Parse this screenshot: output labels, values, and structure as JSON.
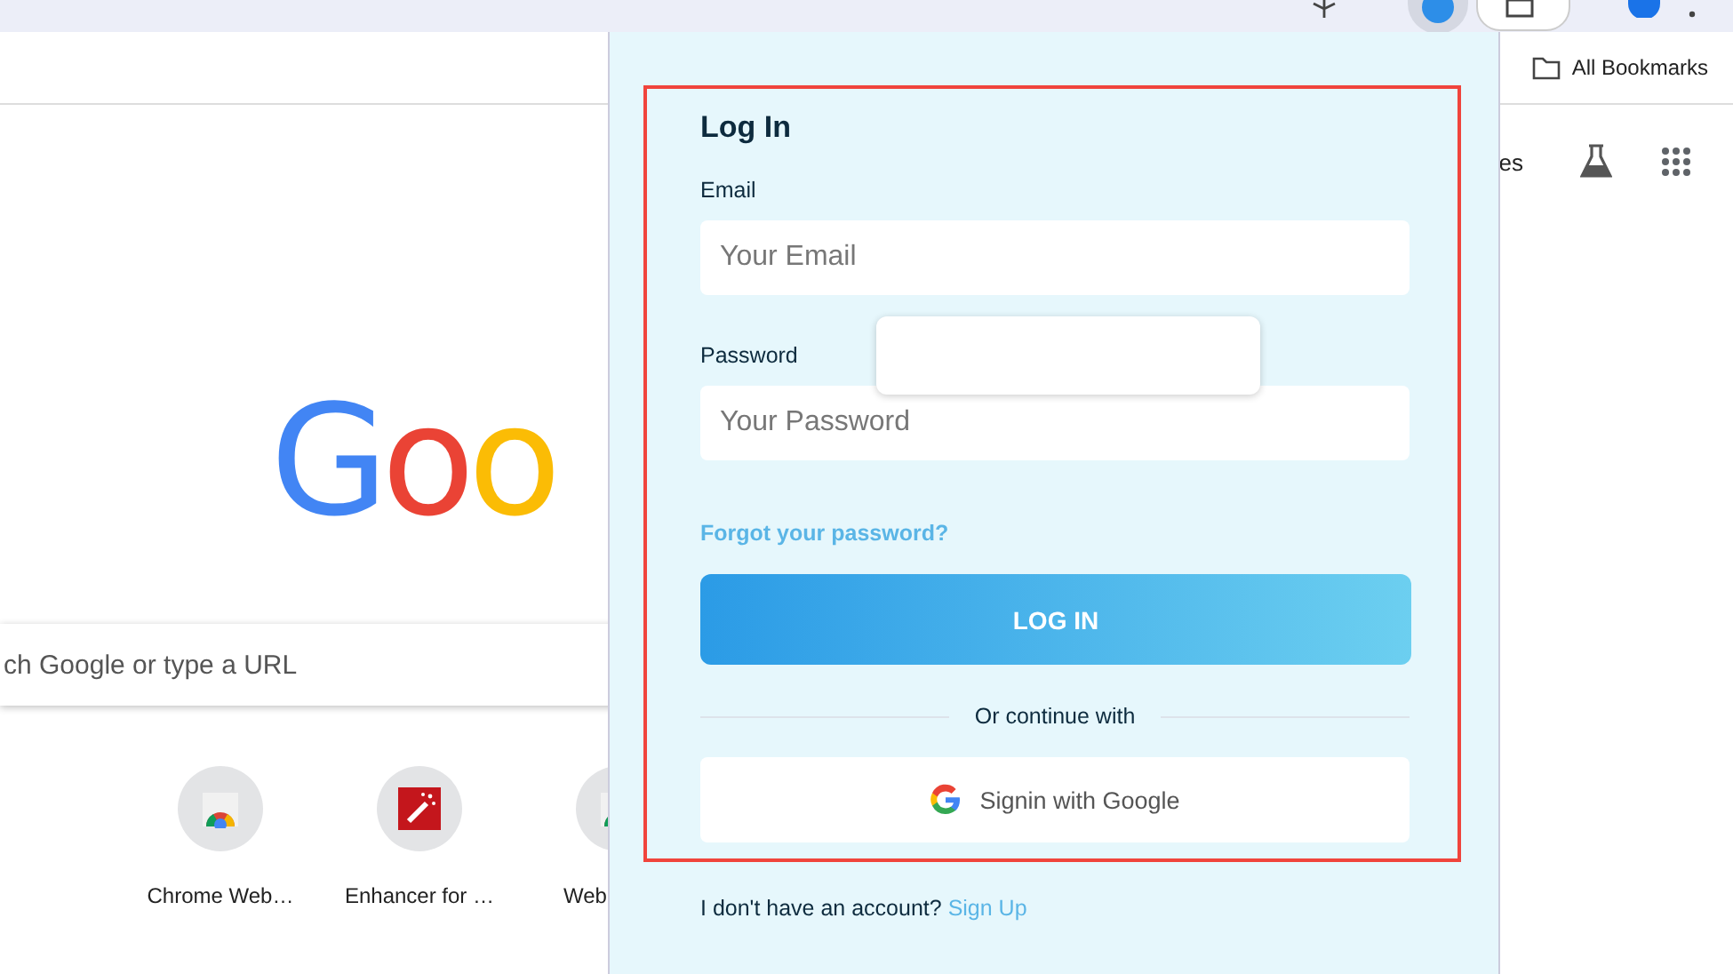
{
  "bookmarks_bar": {
    "label": "All Bookmarks"
  },
  "new_tab": {
    "logo": [
      {
        "char": "G",
        "color": "#4285f4"
      },
      {
        "char": "o",
        "color": "#ea4335"
      },
      {
        "char": "o",
        "color": "#fbbc05"
      }
    ],
    "side_text": "es",
    "search": {
      "placeholder": "ch Google or type a URL"
    },
    "shortcuts": [
      {
        "label": "Chrome Web…",
        "kind": "store"
      },
      {
        "label": "Enhancer for …",
        "kind": "wand"
      },
      {
        "label": "Web",
        "kind": "store"
      }
    ]
  },
  "login_popup": {
    "title": "Log In",
    "fields": [
      {
        "label": "Email",
        "placeholder": "Your Email"
      },
      {
        "label": "Password",
        "placeholder": "Your Password"
      }
    ],
    "forgot_link": "Forgot your password?",
    "login_button": "LOG IN",
    "divider_text": "Or continue with",
    "google_button": "Signin with Google",
    "signup_prompt": "I don't have an account?",
    "signup_link": "Sign Up"
  }
}
